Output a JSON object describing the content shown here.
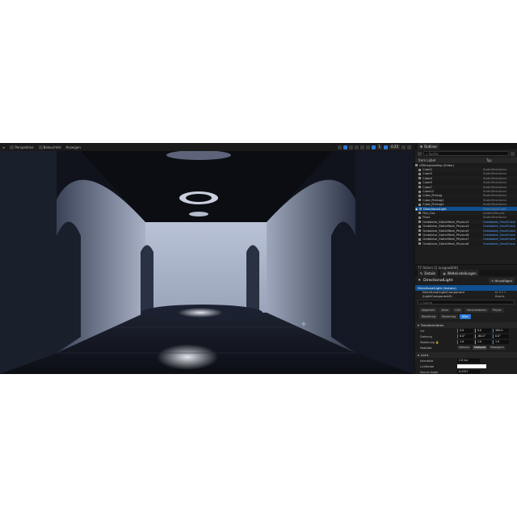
{
  "viewport": {
    "toolbar": {
      "perspective": "Perspektive",
      "lighting": "Beleuchtet",
      "show": "Anzeigen",
      "snap_value": "0.25",
      "grid_value": "1"
    }
  },
  "outliner": {
    "tab_label": "Outliner",
    "search_placeholder": "Suche",
    "col_label": "Item Label",
    "col_type": "Typ",
    "rows": [
      {
        "name": "VRTemplateMap (Editor)",
        "type": ""
      },
      {
        "name": "Cube2",
        "type": "StaticMeshActor"
      },
      {
        "name": "Cube3",
        "type": "StaticMeshActor"
      },
      {
        "name": "Cube4",
        "type": "StaticMeshActor"
      },
      {
        "name": "Cube5",
        "type": "StaticMeshActor"
      },
      {
        "name": "Cube7",
        "type": "StaticMeshActor"
      },
      {
        "name": "Cube12",
        "type": "StaticMeshActor"
      },
      {
        "name": "Cube_FireLog",
        "type": "StaticMeshActor"
      },
      {
        "name": "Cube_FireLog1",
        "type": "StaticMeshActor"
      },
      {
        "name": "Cube_FireLog2",
        "type": "StaticMeshActor"
      },
      {
        "name": "DirectionalLight",
        "type": "DirectionalLight"
      },
      {
        "name": "Fire_Cue",
        "type": "AmbientSound"
      },
      {
        "name": "Floor",
        "type": "StaticMeshActor"
      },
      {
        "name": "GrabActor_StaticMesh_Physics3",
        "type": "Grabbable_SmallCube"
      },
      {
        "name": "GrabActor_StaticMesh_Physics4",
        "type": "Grabbable_SmallCube"
      },
      {
        "name": "GrabActor_StaticMesh_Physics5",
        "type": "Grabbable_SmallCube"
      },
      {
        "name": "GrabActor_StaticMesh_Physics6",
        "type": "Grabbable_SmallCube"
      },
      {
        "name": "GrabActor_StaticMesh_Physics7",
        "type": "Grabbable_SmallCube"
      },
      {
        "name": "GrabActor_StaticMesh_Physics8",
        "type": "Grabbable_SmallCube"
      }
    ],
    "footer": "77 Actors (1 ausgewählt)"
  },
  "details": {
    "tab_details": "Details",
    "tab_world": "Welteinstellungen",
    "actor_name": "DirectionalLight",
    "add_button": "+ Hinzufügen",
    "comp_instance": "DirectionalLight (Instanz)",
    "comp_component": "DirectionalLightComponent (LightComponent0)",
    "comp_cpp": "In C++ Bearb.",
    "search_placeholder": "Suche",
    "categories": [
      "Allgemein",
      "Actor",
      "LOD",
      "Verschiedenes",
      "Physik",
      "Rendering",
      "Streaming",
      "Alles"
    ],
    "section_transform": "Transformieren",
    "location_label": "Ort",
    "rotation_label": "Drehung",
    "scale_label": "Skalierung",
    "location": [
      "0.0",
      "0.0",
      "300.0"
    ],
    "rotation": [
      "0.0°",
      "-60.0°",
      "0.0°"
    ],
    "scale": [
      "1.0",
      "1.0",
      "1.0"
    ],
    "mobility_label": "Mobilität",
    "mobility": [
      "Statisch",
      "Stationär",
      "Beweglich"
    ],
    "section_light": "Licht",
    "intensity_label": "Intensität",
    "intensity": "2.0 lux",
    "light_color_label": "Lichtfarbe",
    "source_angle_label": "Source Angle",
    "source_angle": "0.5357"
  },
  "colors": {
    "accent": "#2a77d6",
    "selection": "#0f4f8f",
    "panel": "#1d1d1d"
  }
}
